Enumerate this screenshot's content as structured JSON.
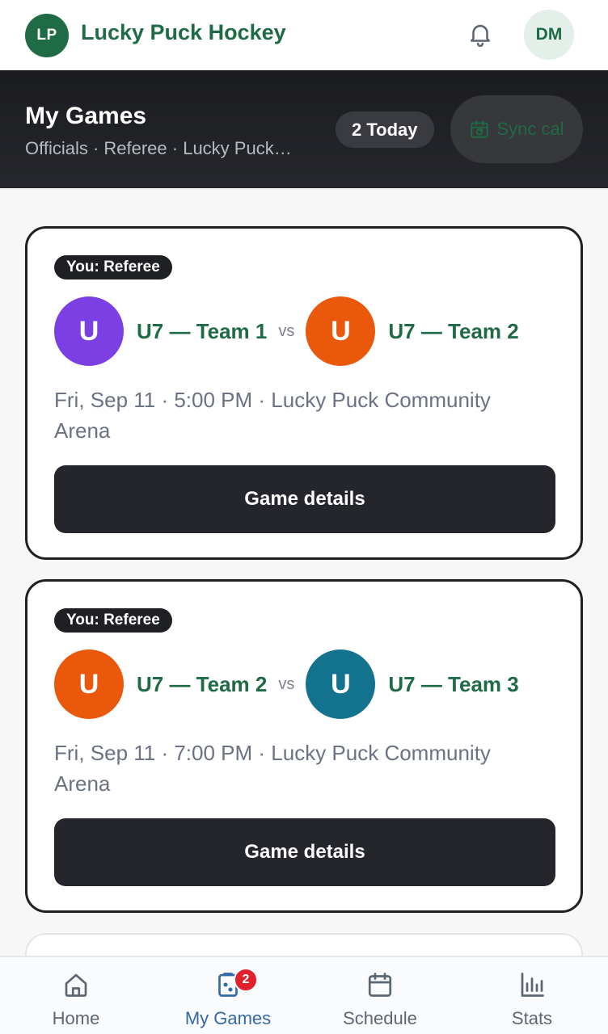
{
  "app": {
    "logo_initials": "LP",
    "title": "Lucky Puck Hockey",
    "user_initials": "DM",
    "brand_color": "#1f6b45"
  },
  "header": {
    "title": "My Games",
    "subtitle": "Officials · Referee · Lucky Puck…",
    "today_pill": "2 Today",
    "sync_label": "Sync cal"
  },
  "games": [
    {
      "role": "You: Referee",
      "home": {
        "initial": "U",
        "name": "U7 — Team 1",
        "color": "#7b3fe4"
      },
      "vs": "vs",
      "away": {
        "initial": "U",
        "name": "U7 — Team 2",
        "color": "#ea580c"
      },
      "info": "Fri, Sep 11 · 5:00 PM · Lucky Puck Community Arena",
      "button": "Game details"
    },
    {
      "role": "You: Referee",
      "home": {
        "initial": "U",
        "name": "U7 — Team 2",
        "color": "#ea580c"
      },
      "vs": "vs",
      "away": {
        "initial": "U",
        "name": "U7 — Team 3",
        "color": "#13728e"
      },
      "info": "Fri, Sep 11 · 7:00 PM · Lucky Puck Community Arena",
      "button": "Game details"
    }
  ],
  "nav": {
    "items": [
      {
        "label": "Home",
        "icon": "home-icon"
      },
      {
        "label": "My Games",
        "icon": "games-icon",
        "badge": "2",
        "active": true
      },
      {
        "label": "Schedule",
        "icon": "calendar-icon"
      },
      {
        "label": "Stats",
        "icon": "stats-icon"
      }
    ]
  }
}
